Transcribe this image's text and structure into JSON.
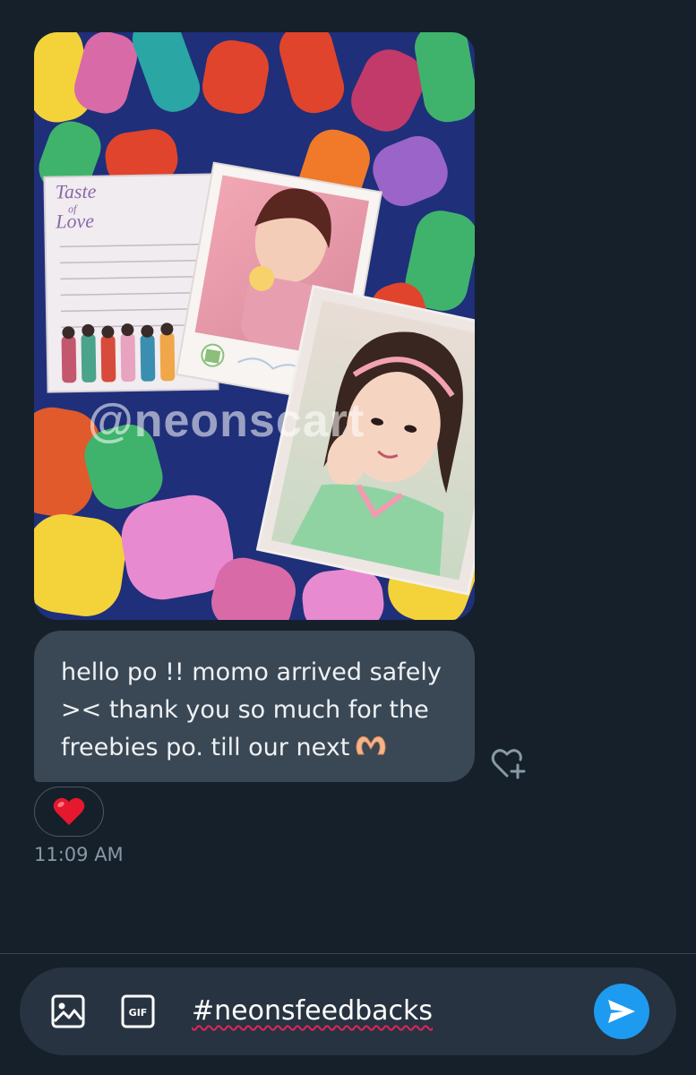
{
  "conversation": {
    "photo": {
      "watermark": "@neonscart",
      "card_title": "Taste of Love",
      "alt_icon": "photo-attachment"
    },
    "message": {
      "text": "hello po !! momo arrived safely >< thank you so much for the freebies po. till our next",
      "emoji": "heart-hands-emoji"
    },
    "reaction": {
      "emoji": "red-heart-emoji",
      "add_reaction_icon": "heart-plus-icon"
    },
    "timestamp": "11:09 AM"
  },
  "composer": {
    "input_value": "#neonsfeedbacks",
    "image_button_icon": "image-icon",
    "gif_button_label": "GIF",
    "send_button_icon": "send-icon"
  },
  "colors": {
    "background": "#15202b",
    "bubble": "#3a4754",
    "accent": "#1d9bf0",
    "timestamp": "#8899a6",
    "spellcheck": "#e0245e"
  }
}
